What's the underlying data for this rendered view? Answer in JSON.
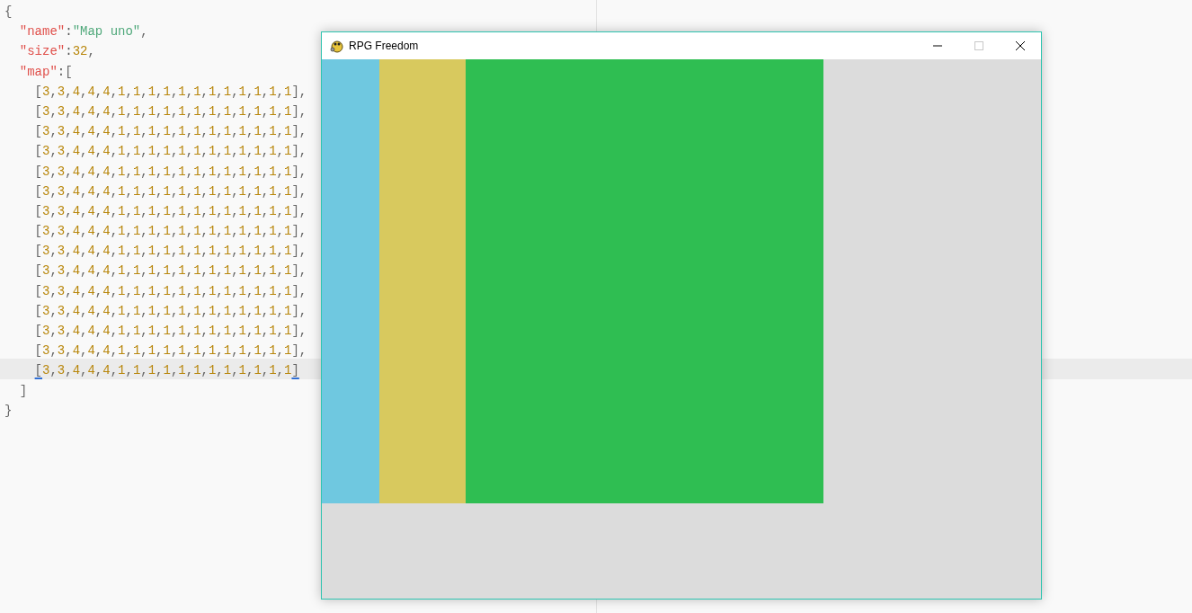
{
  "editor": {
    "lines": [
      {
        "text": "{",
        "highlighted": false
      },
      {
        "text": "  \"name\":\"Map uno\",",
        "highlighted": false
      },
      {
        "text": "  \"size\":32,",
        "highlighted": false
      },
      {
        "text": "  \"map\":[",
        "highlighted": false
      },
      {
        "text": "    [3,3,4,4,4,1,1,1,1,1,1,1,1,1,1,1,1],",
        "highlighted": false
      },
      {
        "text": "    [3,3,4,4,4,1,1,1,1,1,1,1,1,1,1,1,1],",
        "highlighted": false
      },
      {
        "text": "    [3,3,4,4,4,1,1,1,1,1,1,1,1,1,1,1,1],",
        "highlighted": false
      },
      {
        "text": "    [3,3,4,4,4,1,1,1,1,1,1,1,1,1,1,1,1],",
        "highlighted": false
      },
      {
        "text": "    [3,3,4,4,4,1,1,1,1,1,1,1,1,1,1,1,1],",
        "highlighted": false
      },
      {
        "text": "    [3,3,4,4,4,1,1,1,1,1,1,1,1,1,1,1,1],",
        "highlighted": false
      },
      {
        "text": "    [3,3,4,4,4,1,1,1,1,1,1,1,1,1,1,1,1],",
        "highlighted": false
      },
      {
        "text": "    [3,3,4,4,4,1,1,1,1,1,1,1,1,1,1,1,1],",
        "highlighted": false
      },
      {
        "text": "    [3,3,4,4,4,1,1,1,1,1,1,1,1,1,1,1,1],",
        "highlighted": false
      },
      {
        "text": "    [3,3,4,4,4,1,1,1,1,1,1,1,1,1,1,1,1],",
        "highlighted": false
      },
      {
        "text": "    [3,3,4,4,4,1,1,1,1,1,1,1,1,1,1,1,1],",
        "highlighted": false
      },
      {
        "text": "    [3,3,4,4,4,1,1,1,1,1,1,1,1,1,1,1,1],",
        "highlighted": false
      },
      {
        "text": "    [3,3,4,4,4,1,1,1,1,1,1,1,1,1,1,1,1],",
        "highlighted": false
      },
      {
        "text": "    [3,3,4,4,4,1,1,1,1,1,1,1,1,1,1,1,1],",
        "highlighted": false
      },
      {
        "text": "    [3,3,4,4,4,1,1,1,1,1,1,1,1,1,1,1,1]",
        "highlighted": true
      },
      {
        "text": "  ]",
        "highlighted": false
      },
      {
        "text": "}",
        "highlighted": false
      }
    ]
  },
  "window": {
    "title": "RPG Freedom",
    "maximize_disabled": true
  }
}
